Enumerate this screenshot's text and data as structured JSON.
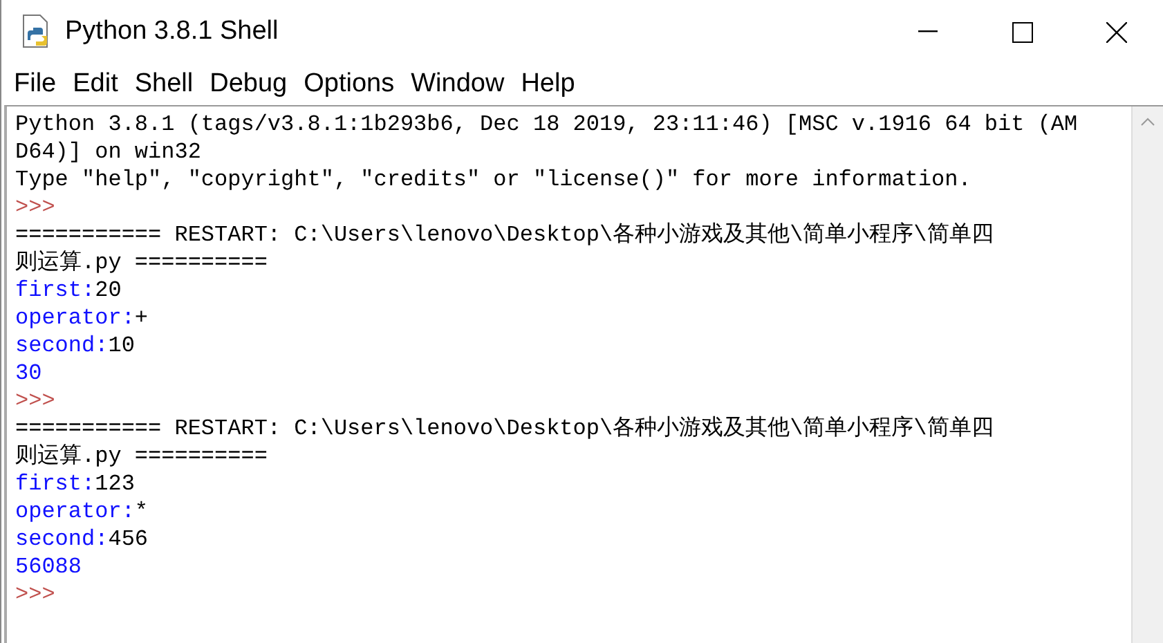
{
  "window": {
    "title": "Python 3.8.1 Shell"
  },
  "menu": [
    "File",
    "Edit",
    "Shell",
    "Debug",
    "Options",
    "Window",
    "Help"
  ],
  "shell_lines": [
    [
      {
        "kind": "plain",
        "text": "Python 3.8.1 (tags/v3.8.1:1b293b6, Dec 18 2019, 23:11:46) [MSC v.1916 64 bit (AM"
      }
    ],
    [
      {
        "kind": "plain",
        "text": "D64)] on win32"
      }
    ],
    [
      {
        "kind": "plain",
        "text": "Type \"help\", \"copyright\", \"credits\" or \"license()\" for more information."
      }
    ],
    [
      {
        "kind": "prompt",
        "text": ">>>"
      }
    ],
    [
      {
        "kind": "plain",
        "text": "=========== RESTART: C:\\Users\\lenovo\\Desktop\\各种小游戏及其他\\简单小程序\\简单四"
      }
    ],
    [
      {
        "kind": "plain",
        "text": "则运算.py =========="
      }
    ],
    [
      {
        "kind": "stdout",
        "text": "first:"
      },
      {
        "kind": "input",
        "text": "20"
      }
    ],
    [
      {
        "kind": "stdout",
        "text": "operator:"
      },
      {
        "kind": "input",
        "text": "+"
      }
    ],
    [
      {
        "kind": "stdout",
        "text": "second:"
      },
      {
        "kind": "input",
        "text": "10"
      }
    ],
    [
      {
        "kind": "stdout",
        "text": "30"
      }
    ],
    [
      {
        "kind": "prompt",
        "text": ">>>"
      }
    ],
    [
      {
        "kind": "plain",
        "text": "=========== RESTART: C:\\Users\\lenovo\\Desktop\\各种小游戏及其他\\简单小程序\\简单四"
      }
    ],
    [
      {
        "kind": "plain",
        "text": "则运算.py =========="
      }
    ],
    [
      {
        "kind": "stdout",
        "text": "first:"
      },
      {
        "kind": "input",
        "text": "123"
      }
    ],
    [
      {
        "kind": "stdout",
        "text": "operator:"
      },
      {
        "kind": "input",
        "text": "*"
      }
    ],
    [
      {
        "kind": "stdout",
        "text": "second:"
      },
      {
        "kind": "input",
        "text": "456"
      }
    ],
    [
      {
        "kind": "stdout",
        "text": "56088"
      }
    ],
    [
      {
        "kind": "prompt",
        "text": ">>>"
      }
    ]
  ]
}
